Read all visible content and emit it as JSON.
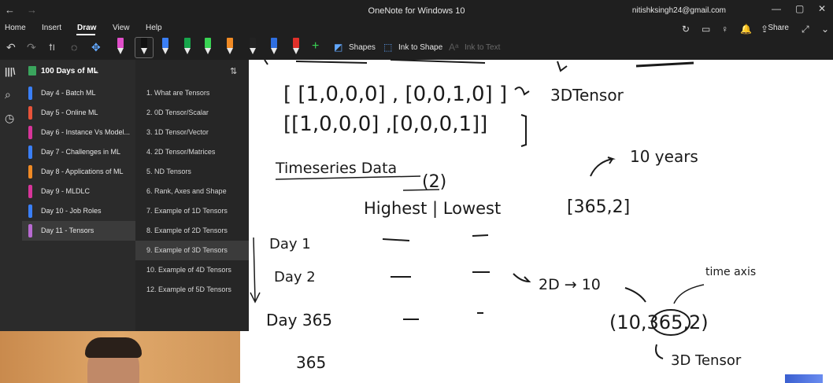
{
  "titlebar": {
    "back_icon": "←",
    "forward_icon": "→",
    "title": "OneNote for Windows 10",
    "account": "nitishksingh24@gmail.com",
    "minimize_icon": "—",
    "maximize_icon": "▢",
    "close_icon": "✕"
  },
  "ribbon": {
    "tabs": [
      "Home",
      "Insert",
      "Draw",
      "View",
      "Help"
    ],
    "active_tab": "Draw",
    "share_label": "Share",
    "share_icon": "⇪",
    "right_icons": [
      "↻",
      "▭",
      "♀",
      "🔔",
      "⤢",
      "⌄"
    ]
  },
  "toolbar": {
    "undo_icon": "↶",
    "redo_icon": "↷",
    "type_select_icon": "ꝉI",
    "lasso_icon": "◌",
    "pan_icon": "✥",
    "pens": [
      {
        "name": "highlighter-pink",
        "color": "#e04ec9"
      },
      {
        "name": "pen-black",
        "color": "#111111"
      },
      {
        "name": "pen-blue",
        "color": "#3a7ff6"
      },
      {
        "name": "pen-green",
        "color": "#17a54b"
      },
      {
        "name": "pen-green-bright",
        "color": "#39d353"
      },
      {
        "name": "pen-orange",
        "color": "#f08a24"
      },
      {
        "name": "pen-dark",
        "color": "#222222"
      },
      {
        "name": "pen-blue-2",
        "color": "#2f6fe0"
      },
      {
        "name": "pen-red",
        "color": "#e0302a"
      }
    ],
    "add_pen_icon": "+",
    "shapes_label": "Shapes",
    "ink_to_shape_label": "Ink to Shape",
    "ink_to_text_label": "Ink to Text"
  },
  "rail": {
    "icons": [
      "|||\\",
      "⌕",
      "◷"
    ]
  },
  "notebook": {
    "title": "100 Days of ML",
    "chevron": "⌄",
    "sections": [
      {
        "label": "Day 4 - Batch ML",
        "color": "#3a7ff6"
      },
      {
        "label": "Day 5 - Online ML",
        "color": "#e8533a"
      },
      {
        "label": "Day 6 - Instance Vs Model...",
        "color": "#d7359a"
      },
      {
        "label": "Day 7 - Challenges in ML",
        "color": "#3a7ff6"
      },
      {
        "label": "Day 8 - Applications of ML",
        "color": "#f08a24"
      },
      {
        "label": "Day 9 - MLDLC",
        "color": "#d7359a"
      },
      {
        "label": "Day 10 - Job Roles",
        "color": "#3a7ff6"
      },
      {
        "label": "Day 11 - Tensors",
        "color": "#b86ad1"
      }
    ],
    "selected_section": 7
  },
  "pages": {
    "sort_icon": "⇅",
    "items": [
      "1. What are Tensors",
      "2. 0D Tensor/Scalar",
      "3. 1D Tensor/Vector",
      "4. 2D Tensor/Matrices",
      "5. ND Tensors",
      "6. Rank, Axes and Shape",
      "7. Example of 1D Tensors",
      "8. Example of 2D Tensors",
      "9. Example of 3D Tensors",
      "10. Example of 4D Tensors",
      "12. Example of 5D Tensors"
    ],
    "selected_page": 8
  },
  "ink": {
    "row1": "[ [1,0,0,0] , [0,0,1,0] ]",
    "row1_note": "3DTensor",
    "row2": "[[1,0,0,0] ,[0,0,0,1]]",
    "heading": "Timeseries Data",
    "paren2": "(2)",
    "subheading": "Highest | Lowest",
    "years": "10 years",
    "shape1": "[365,2]",
    "day1": "Day 1",
    "day2": "Day 2",
    "day365": "Day 365",
    "count365": "365",
    "arrow_2d": "2D → 10",
    "time_axis": "time axis",
    "shape2": "(10,365,2)",
    "tensor3d": "3D Tensor"
  }
}
